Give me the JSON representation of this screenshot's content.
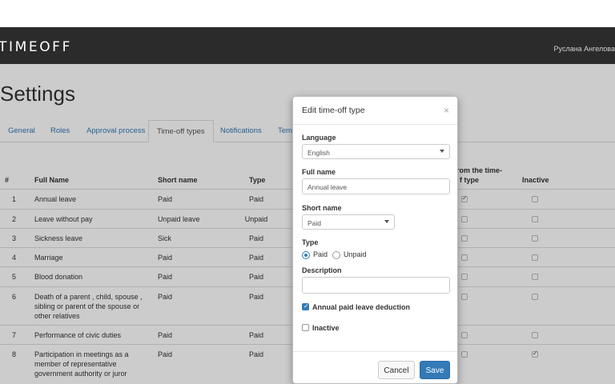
{
  "app": {
    "brand": "TIMEOFF",
    "user_name": "Руслана Ангелова"
  },
  "page": {
    "title": "Settings"
  },
  "tabs": [
    "General",
    "Roles",
    "Approval process",
    "Time-off types",
    "Notifications",
    "Tem"
  ],
  "table": {
    "headers": [
      "#",
      "Full Name",
      "Short name",
      "Type",
      "rom the time-",
      "f type",
      "Inactive"
    ],
    "rows": [
      {
        "num": "1",
        "full1": "Annual leave",
        "full2": "",
        "full3": "",
        "short": "Paid",
        "type": "Paid",
        "deduct": true,
        "inactive": false
      },
      {
        "num": "2",
        "full1": "Leave without pay",
        "full2": "",
        "full3": "",
        "short": "Unpaid leave",
        "type": "Unpaid",
        "deduct": false,
        "inactive": false
      },
      {
        "num": "3",
        "full1": "Sickness leave",
        "full2": "",
        "full3": "",
        "short": "Sick",
        "type": "Paid",
        "deduct": false,
        "inactive": false
      },
      {
        "num": "4",
        "full1": "Marriage",
        "full2": "",
        "full3": "",
        "short": "Paid",
        "type": "Paid",
        "deduct": false,
        "inactive": false
      },
      {
        "num": "5",
        "full1": "Blood donation",
        "full2": "",
        "full3": "",
        "short": "Paid",
        "type": "Paid",
        "deduct": false,
        "inactive": false
      },
      {
        "num": "6",
        "full1": "Death of a parent , child, spouse ,",
        "full2": "sibling or parent of the spouse or",
        "full3": "other relatives",
        "short": "Paid",
        "type": "Paid",
        "deduct": false,
        "inactive": false
      },
      {
        "num": "7",
        "full1": "Performance of civic duties",
        "full2": "",
        "full3": "",
        "short": "Paid",
        "type": "Paid",
        "deduct": false,
        "inactive": false
      },
      {
        "num": "8",
        "full1": "Participation in meetings as a",
        "full2": "member of representative",
        "full3": "government authority or juror",
        "short": "Paid",
        "type": "Paid",
        "deduct": false,
        "inactive": true
      }
    ]
  },
  "modal": {
    "title": "Edit time-off type",
    "close": "×",
    "language_label": "Language",
    "language_value": "English",
    "full_name_label": "Full name",
    "full_name_value": "Annual leave",
    "short_name_label": "Short name",
    "short_name_value": "Paid",
    "type_label": "Type",
    "type_options": [
      "Paid",
      "Unpaid"
    ],
    "type_selected": "Paid",
    "description_label": "Description",
    "description_value": "",
    "deduction_label": "Annual paid leave deduction",
    "deduction_checked": true,
    "inactive_label": "Inactive",
    "inactive_checked": false,
    "cancel_label": "Cancel",
    "save_label": "Save",
    "save_color": "#337ab7"
  }
}
